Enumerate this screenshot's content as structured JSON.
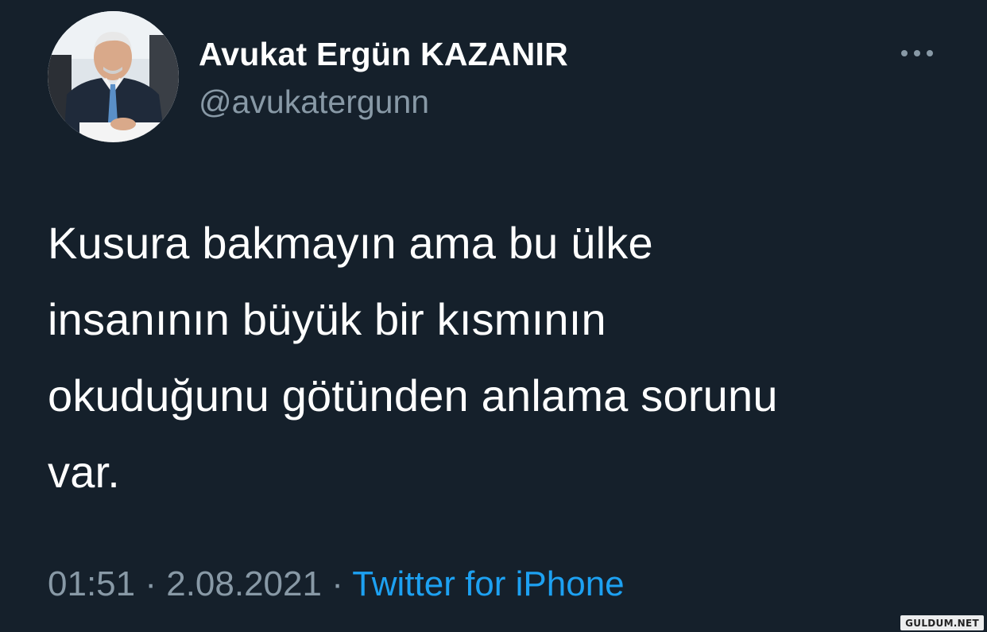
{
  "author": {
    "name": "Avukat Ergün KAZANIR",
    "handle": "@avukatergunn"
  },
  "tweet": {
    "text": "Kusura bakmayın ama bu ülke\ninsanının büyük bir kısmının\nokuduğunu götünden anlama sorunu\nvar."
  },
  "meta": {
    "time": "01:51",
    "separator1": " · ",
    "date": "2.08.2021",
    "separator2": " · ",
    "source": "Twitter for iPhone"
  },
  "icons": {
    "more": "more-horizontal-icon"
  },
  "watermark": "GULDUM.NET",
  "colors": {
    "background": "#15202b",
    "text": "#ffffff",
    "secondary": "#8899a6",
    "link": "#1da1f2"
  }
}
